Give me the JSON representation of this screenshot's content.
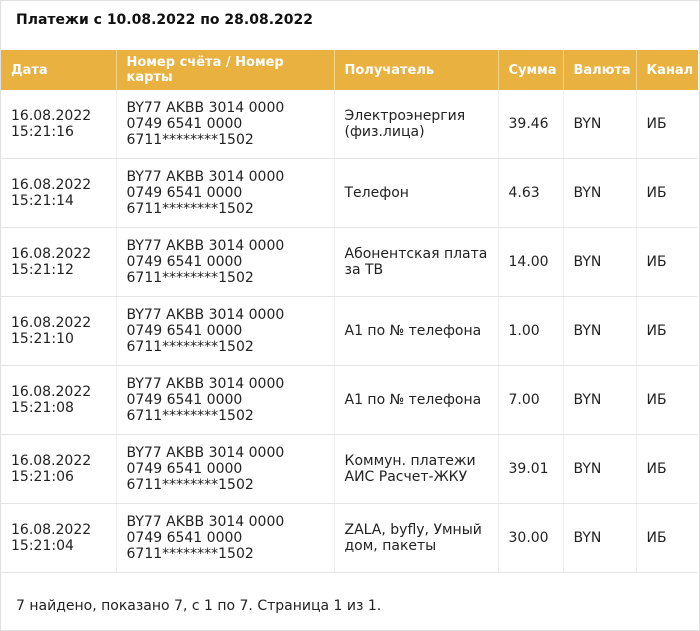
{
  "title": "Платежи с 10.08.2022 по 28.08.2022",
  "columns": [
    "Дата",
    "Номер счёта / Номер карты",
    "Получатель",
    "Сумма",
    "Валюта",
    "Канал"
  ],
  "rows": [
    {
      "date": "16.08.2022",
      "time": "15:21:16",
      "acc1": "BY77 AKBB 3014 0000",
      "acc2": "0749 6541 0000",
      "card": "6711********1502",
      "rec1": "Электроэнергия",
      "rec2": "(физ.лица)",
      "sum": "39.46",
      "cur": "BYN",
      "chan": "ИБ"
    },
    {
      "date": "16.08.2022",
      "time": "15:21:14",
      "acc1": "BY77 AKBB 3014 0000",
      "acc2": "0749 6541 0000",
      "card": "6711********1502",
      "rec1": "Телефон",
      "rec2": "",
      "sum": "4.63",
      "cur": "BYN",
      "chan": "ИБ"
    },
    {
      "date": "16.08.2022",
      "time": "15:21:12",
      "acc1": "BY77 AKBB 3014 0000",
      "acc2": "0749 6541 0000",
      "card": "6711********1502",
      "rec1": "Абонентская плата",
      "rec2": "за ТВ",
      "sum": "14.00",
      "cur": "BYN",
      "chan": "ИБ"
    },
    {
      "date": "16.08.2022",
      "time": "15:21:10",
      "acc1": "BY77 AKBB 3014 0000",
      "acc2": "0749 6541 0000",
      "card": "6711********1502",
      "rec1": "А1 по № телефона",
      "rec2": "",
      "sum": "1.00",
      "cur": "BYN",
      "chan": "ИБ"
    },
    {
      "date": "16.08.2022",
      "time": "15:21:08",
      "acc1": "BY77 AKBB 3014 0000",
      "acc2": "0749 6541 0000",
      "card": "6711********1502",
      "rec1": "А1 по № телефона",
      "rec2": "",
      "sum": "7.00",
      "cur": "BYN",
      "chan": "ИБ"
    },
    {
      "date": "16.08.2022",
      "time": "15:21:06",
      "acc1": "BY77 AKBB 3014 0000",
      "acc2": "0749 6541 0000",
      "card": "6711********1502",
      "rec1": "Коммун. платежи",
      "rec2": "АИС Расчет-ЖКУ",
      "sum": "39.01",
      "cur": "BYN",
      "chan": "ИБ"
    },
    {
      "date": "16.08.2022",
      "time": "15:21:04",
      "acc1": "BY77 AKBB 3014 0000",
      "acc2": "0749 6541 0000",
      "card": "6711********1502",
      "rec1": "ZALA, byfly, Умный",
      "rec2": "дом, пакеты",
      "sum": "30.00",
      "cur": "BYN",
      "chan": "ИБ"
    }
  ],
  "footer": "7 найдено, показано 7, с 1 по 7. Страница 1 из 1.",
  "colors": {
    "header_bg": "#e9b13f",
    "header_text": "#ffffff"
  }
}
